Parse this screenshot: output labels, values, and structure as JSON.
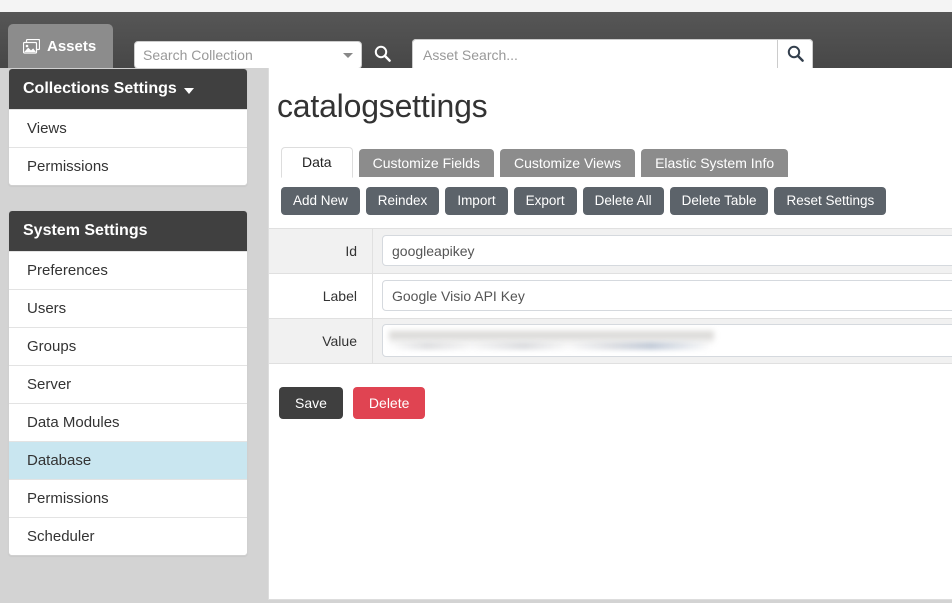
{
  "header": {
    "assets_tab_label": "Assets",
    "assets_icon": "image-icon",
    "collection_select_value": "Search Collection",
    "collection_search_icon": "search-icon",
    "asset_search_placeholder": "Asset Search...",
    "asset_search_value": "",
    "asset_search_icon": "search-icon"
  },
  "sidebar": {
    "collections": {
      "title": "Collections Settings",
      "caret_icon": "caret-down-icon",
      "items": [
        {
          "label": "Views",
          "active": false
        },
        {
          "label": "Permissions",
          "active": false
        }
      ]
    },
    "system": {
      "title": "System Settings",
      "items": [
        {
          "label": "Preferences",
          "active": false
        },
        {
          "label": "Users",
          "active": false
        },
        {
          "label": "Groups",
          "active": false
        },
        {
          "label": "Server",
          "active": false
        },
        {
          "label": "Data Modules",
          "active": false
        },
        {
          "label": "Database",
          "active": true
        },
        {
          "label": "Permissions",
          "active": false
        },
        {
          "label": "Scheduler",
          "active": false
        }
      ]
    }
  },
  "main": {
    "page_title": "catalogsettings",
    "tabs": [
      {
        "label": "Data",
        "active": true
      },
      {
        "label": "Customize Fields",
        "active": false
      },
      {
        "label": "Customize Views",
        "active": false
      },
      {
        "label": "Elastic System Info",
        "active": false
      }
    ],
    "toolbar": [
      {
        "label": "Add New"
      },
      {
        "label": "Reindex"
      },
      {
        "label": "Import"
      },
      {
        "label": "Export"
      },
      {
        "label": "Delete All"
      },
      {
        "label": "Delete Table"
      },
      {
        "label": "Reset Settings"
      }
    ],
    "fields": [
      {
        "label": "Id",
        "value": "googleapikey",
        "redacted": false
      },
      {
        "label": "Label",
        "value": "Google Visio API Key",
        "redacted": false
      },
      {
        "label": "Value",
        "value": "",
        "redacted": true
      }
    ],
    "actions": {
      "save_label": "Save",
      "delete_label": "Delete"
    }
  },
  "colors": {
    "header_bg": "#4d4d4d",
    "panel_head_bg": "#404040",
    "active_nav_bg": "#c9e6f0",
    "toolbar_btn_bg": "#5c636a",
    "save_bg": "#3f3f3f",
    "delete_bg": "#e04452",
    "page_bg": "#d3d3d3"
  }
}
